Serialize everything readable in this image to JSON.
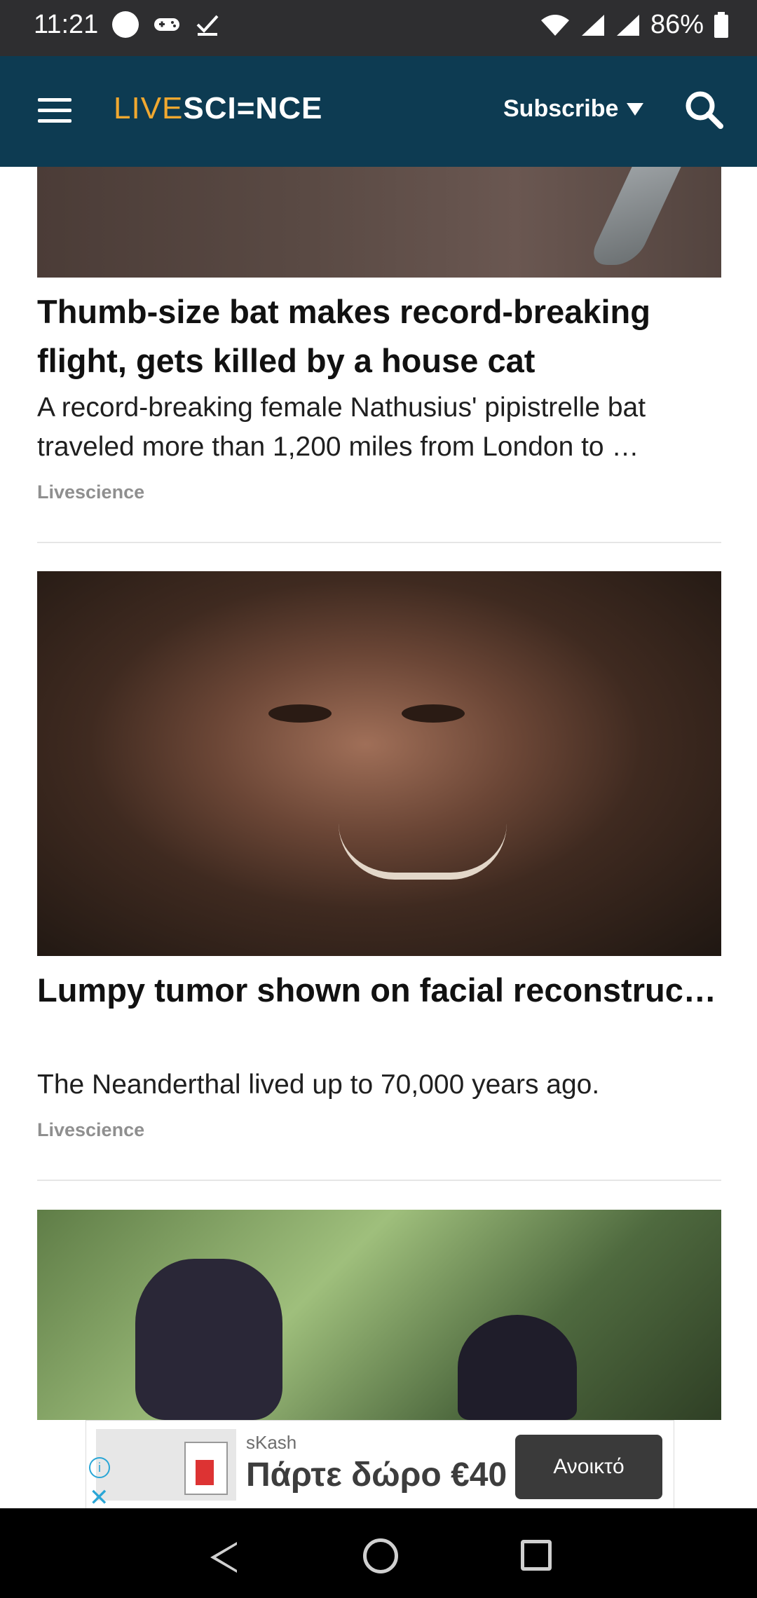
{
  "status": {
    "time": "11:21",
    "battery": "86%",
    "icons": [
      "circle-icon",
      "game-controller-icon",
      "check-icon",
      "wifi-icon",
      "signal-icon",
      "signal-icon",
      "battery-icon"
    ]
  },
  "header": {
    "logo_live": "LIVE",
    "logo_science": "SCI=NCE",
    "subscribe_label": "Subscribe"
  },
  "articles": [
    {
      "title": "Thumb-size bat makes record-breaking flight, gets killed by a house cat",
      "description": "A record-breaking female Nathusius' pipistrelle bat traveled more than 1,200 miles from London to …",
      "source": "Livescience"
    },
    {
      "title": "Lumpy tumor shown on facial reconstruction of Neanderthal who live…",
      "description": "The Neanderthal lived up to 70,000 years ago.",
      "source": "Livescience"
    }
  ],
  "ad": {
    "brand": "sKash",
    "headline": "Πάρτε δώρο €40",
    "cta": "Ανοικτό"
  },
  "colors": {
    "header_bg": "#0d3b52",
    "logo_live": "#f0a830",
    "status_bg": "#2e2e30"
  }
}
